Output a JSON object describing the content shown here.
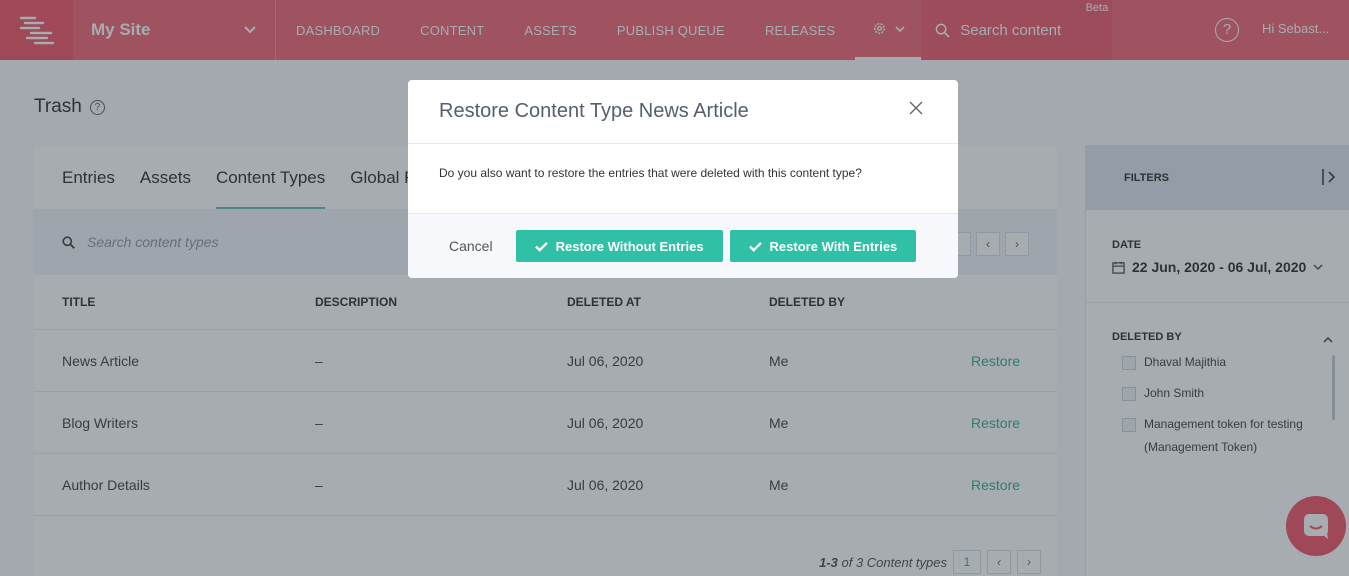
{
  "nav": {
    "site_name": "My Site",
    "items": [
      "DASHBOARD",
      "CONTENT",
      "ASSETS",
      "PUBLISH QUEUE",
      "RELEASES"
    ],
    "search_placeholder": "Search content",
    "beta": "Beta",
    "help": "?",
    "user": "Hi  Sebast..."
  },
  "page": {
    "title": "Trash",
    "tabs": [
      "Entries",
      "Assets",
      "Content Types",
      "Global F"
    ],
    "search_placeholder": "Search content types",
    "columns": [
      "TITLE",
      "DESCRIPTION",
      "DELETED AT",
      "DELETED BY"
    ],
    "rows": [
      {
        "title": "News Article",
        "description": "–",
        "deleted_at": "Jul 06, 2020",
        "deleted_by": "Me",
        "action": "Restore"
      },
      {
        "title": "Blog Writers",
        "description": "–",
        "deleted_at": "Jul 06, 2020",
        "deleted_by": "Me",
        "action": "Restore"
      },
      {
        "title": "Author Details",
        "description": "–",
        "deleted_at": "Jul 06, 2020",
        "deleted_by": "Me",
        "action": "Restore"
      }
    ],
    "footer": {
      "range": "1-3",
      "of_text": " of 3 Content types",
      "page": "1"
    }
  },
  "filters": {
    "title": "FILTERS",
    "date_label": "DATE",
    "date_value": "22 Jun, 2020 - 06 Jul, 2020",
    "deleted_by_label": "DELETED BY",
    "users": [
      "Dhaval Majithia",
      "John Smith",
      "Management token for testing (Management Token)"
    ]
  },
  "modal": {
    "title": "Restore Content Type News Article",
    "message": "Do you also want to restore the entries that were deleted with this content type?",
    "cancel": "Cancel",
    "restore_without": "Restore Without Entries",
    "restore_with": "Restore With Entries"
  },
  "colors": {
    "nav": "#f05c6e",
    "accent": "#2fc0a5",
    "link": "#28a593"
  }
}
